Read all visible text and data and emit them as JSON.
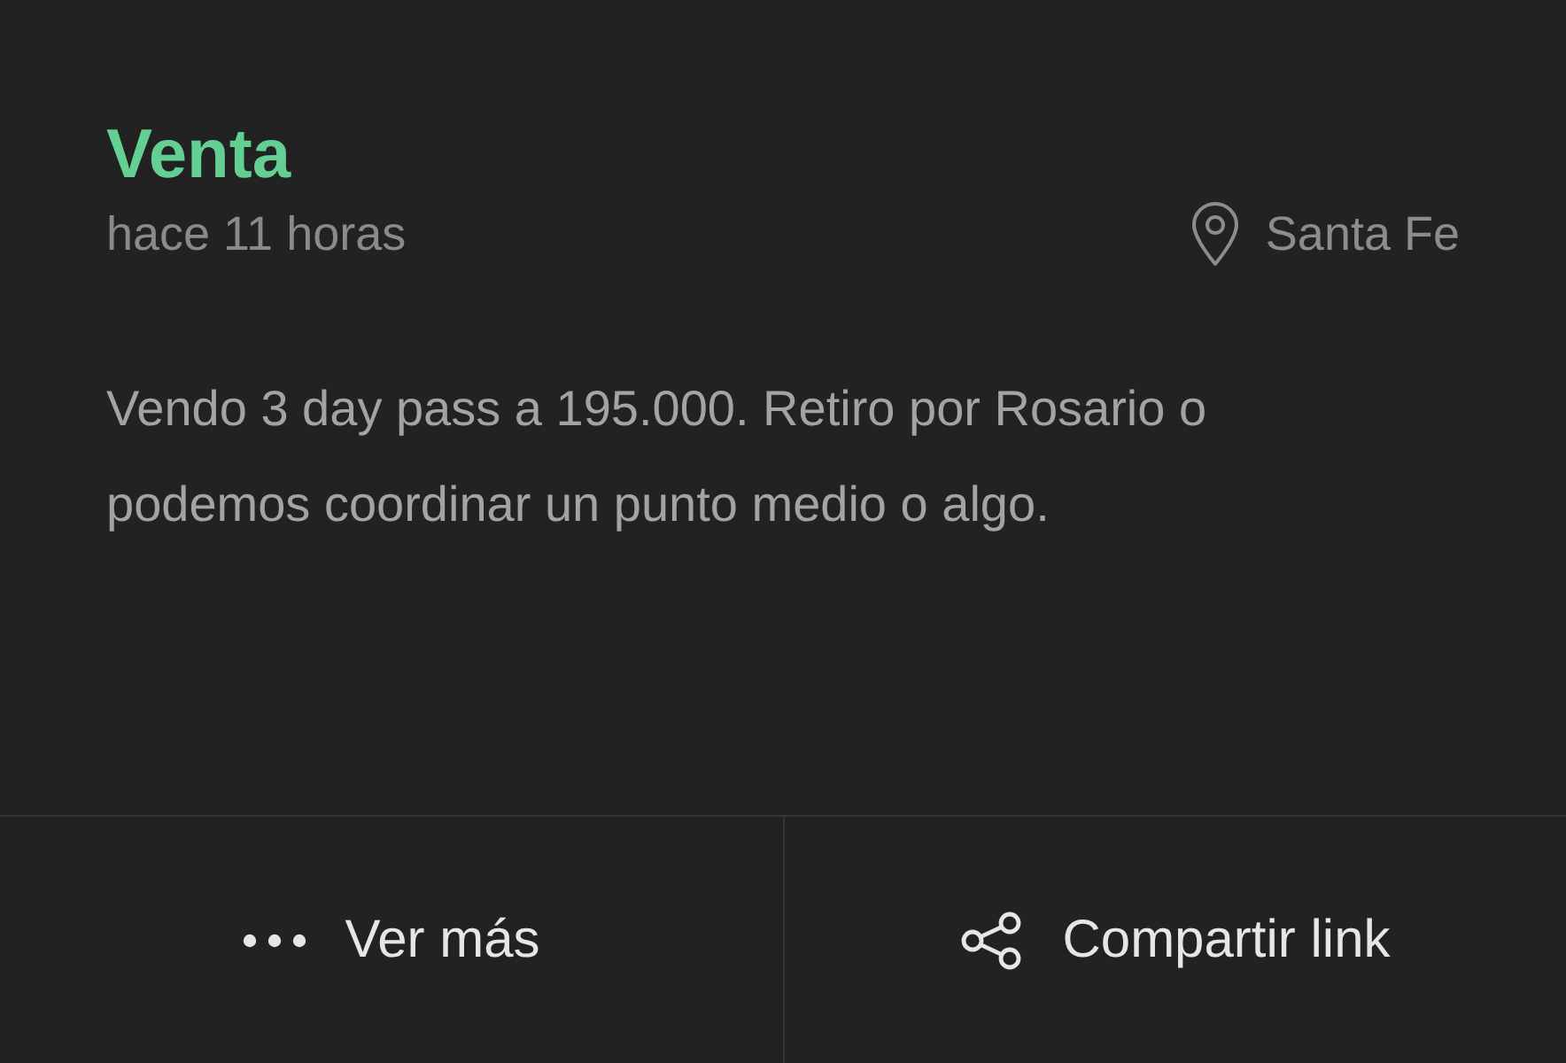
{
  "post": {
    "title": "Venta",
    "time": "hace 11 horas",
    "location": "Santa Fe",
    "text": "Vendo 3 day pass a 195.000. Retiro por Rosario o podemos coordinar un punto medio o algo."
  },
  "actions": [
    {
      "kind": "more",
      "label": "Ver más"
    },
    {
      "kind": "share",
      "label": "Compartir link"
    }
  ]
}
